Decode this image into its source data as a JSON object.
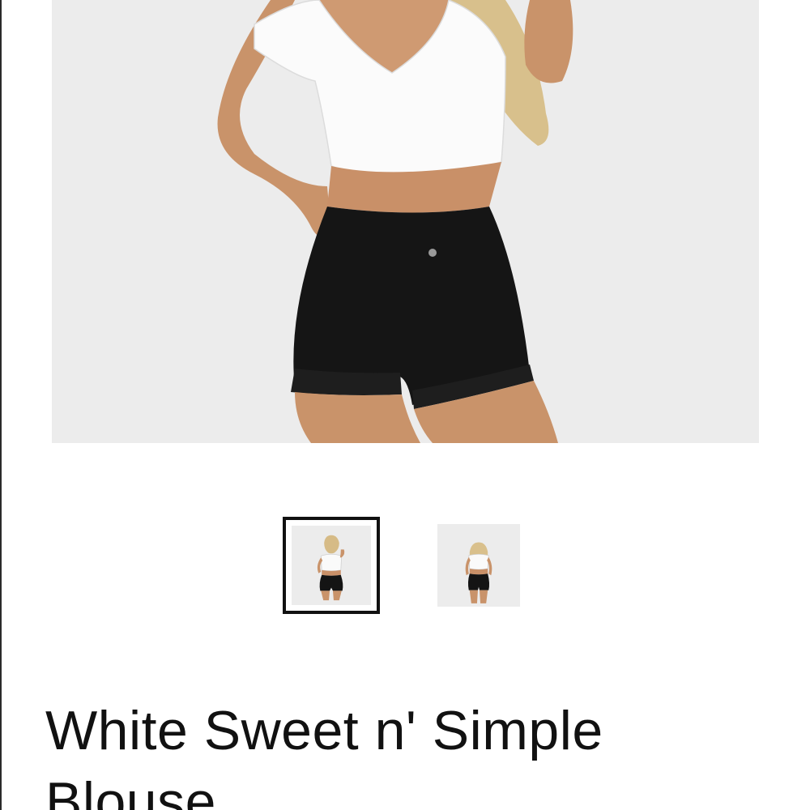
{
  "product": {
    "title": "White Sweet n' Simple Blouse",
    "main_image_alt": "Model wearing white tie-front blouse with black denim shorts"
  },
  "gallery": {
    "thumbnails": [
      {
        "alt": "Front view",
        "active": true
      },
      {
        "alt": "Back view",
        "active": false
      }
    ]
  },
  "colors": {
    "background": "#ffffff",
    "photo_backdrop": "#ebebeb",
    "active_border": "#111111",
    "title_text": "#111111"
  }
}
